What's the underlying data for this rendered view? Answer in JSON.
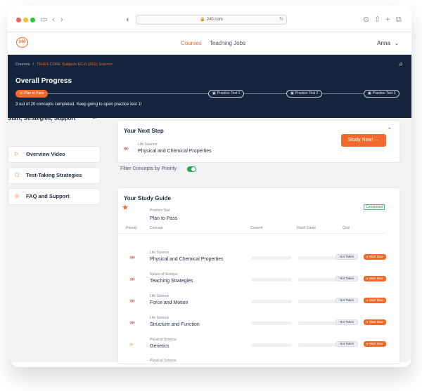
{
  "browser": {
    "url": "240.com"
  },
  "nav": {
    "logo": "240",
    "links": [
      "Courses",
      "Teaching Jobs"
    ],
    "user": "Anna"
  },
  "hero": {
    "crumb_root": "Courses",
    "crumb_current": "TExES CORE Subjects EC-6 (391): Science",
    "title": "Overall Progress",
    "milestones": [
      "Plan to Pass",
      "Practice Test 1",
      "Practice Test 2",
      "Practice Test 3"
    ],
    "message": "3 out of 20 concepts completed. Keep going to open practice test 1!"
  },
  "sidebar": {
    "title": "Start, Strategies, Support",
    "items": [
      "Overview Video",
      "Test-Taking Strategies",
      "FAQ and Support"
    ]
  },
  "next_step": {
    "title": "Your Next Step",
    "subject": "Life Science",
    "concept": "Physical and Chemical Properties",
    "button": "Study Now!"
  },
  "filter": {
    "label": "Filter Concepts by Priority",
    "enabled": true
  },
  "guide": {
    "title": "Your Study Guide",
    "practice_label": "Practice Test",
    "practice_name": "Plan to Pass",
    "practice_status": "Completed",
    "headers": [
      "Priority",
      "Concept",
      "Content",
      "Flash Cards",
      "Quiz"
    ],
    "rows": [
      {
        "subject": "Life Science",
        "concept": "Physical and Chemical Properties",
        "quiz": "Not Taken",
        "action": "Start Now"
      },
      {
        "subject": "Nature of Science",
        "concept": "Teaching Strategies",
        "quiz": "Not Taken",
        "action": "Start Now"
      },
      {
        "subject": "Life Science",
        "concept": "Force and Motion",
        "quiz": "Not Taken",
        "action": "Start Now"
      },
      {
        "subject": "Life Science",
        "concept": "Structure and Function",
        "quiz": "Not Taken",
        "action": "Start Now"
      },
      {
        "subject": "Physical Science",
        "concept": "Genetics",
        "quiz": "Not Taken",
        "action": "Start Now"
      },
      {
        "subject": "Physical Science"
      }
    ]
  },
  "colors": {
    "accent": "#f06a2c",
    "navy": "#14253d",
    "high_priority": "#e2444f",
    "medium_priority": "#f28a3b",
    "success": "#22a45d"
  }
}
